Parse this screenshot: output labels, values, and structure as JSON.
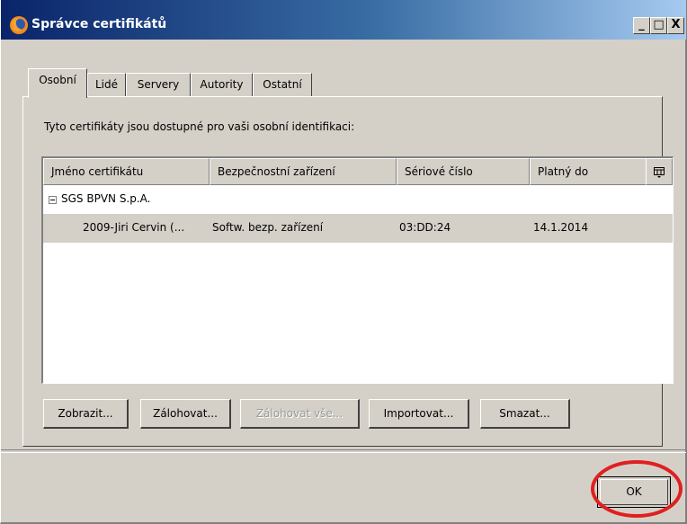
{
  "window": {
    "title": "Správce certifikátů",
    "controls": {
      "minimize": "_",
      "maximize": "□",
      "close": "X"
    }
  },
  "tabs": [
    {
      "label": "Osobní",
      "active": true
    },
    {
      "label": "Lidé",
      "active": false
    },
    {
      "label": "Servery",
      "active": false
    },
    {
      "label": "Autority",
      "active": false
    },
    {
      "label": "Ostatní",
      "active": false
    }
  ],
  "panel": {
    "description": "Tyto certifikáty jsou dostupné pro vaši osobní identifikaci:"
  },
  "table": {
    "columns": [
      "Jméno certifikátu",
      "Bezpečnostní zařízení",
      "Sériové číslo",
      "Platný do"
    ],
    "groups": [
      {
        "name": "SGS BPVN S.p.A.",
        "rows": [
          {
            "name": "2009-Jiri Cervin (...",
            "device": "Softw. bezp. zařízení",
            "serial": "03:DD:24",
            "valid_to": "14.1.2014"
          }
        ]
      }
    ]
  },
  "buttons": {
    "view": "Zobrazit...",
    "backup": "Zálohovat...",
    "backup_all": "Zálohovat vše...",
    "import": "Importovat...",
    "delete": "Smazat..."
  },
  "ok": "OK",
  "colors": {
    "highlight_circle": "#e02020",
    "titlebar": "#0a246a",
    "selected_row": "#d4d0c8"
  }
}
